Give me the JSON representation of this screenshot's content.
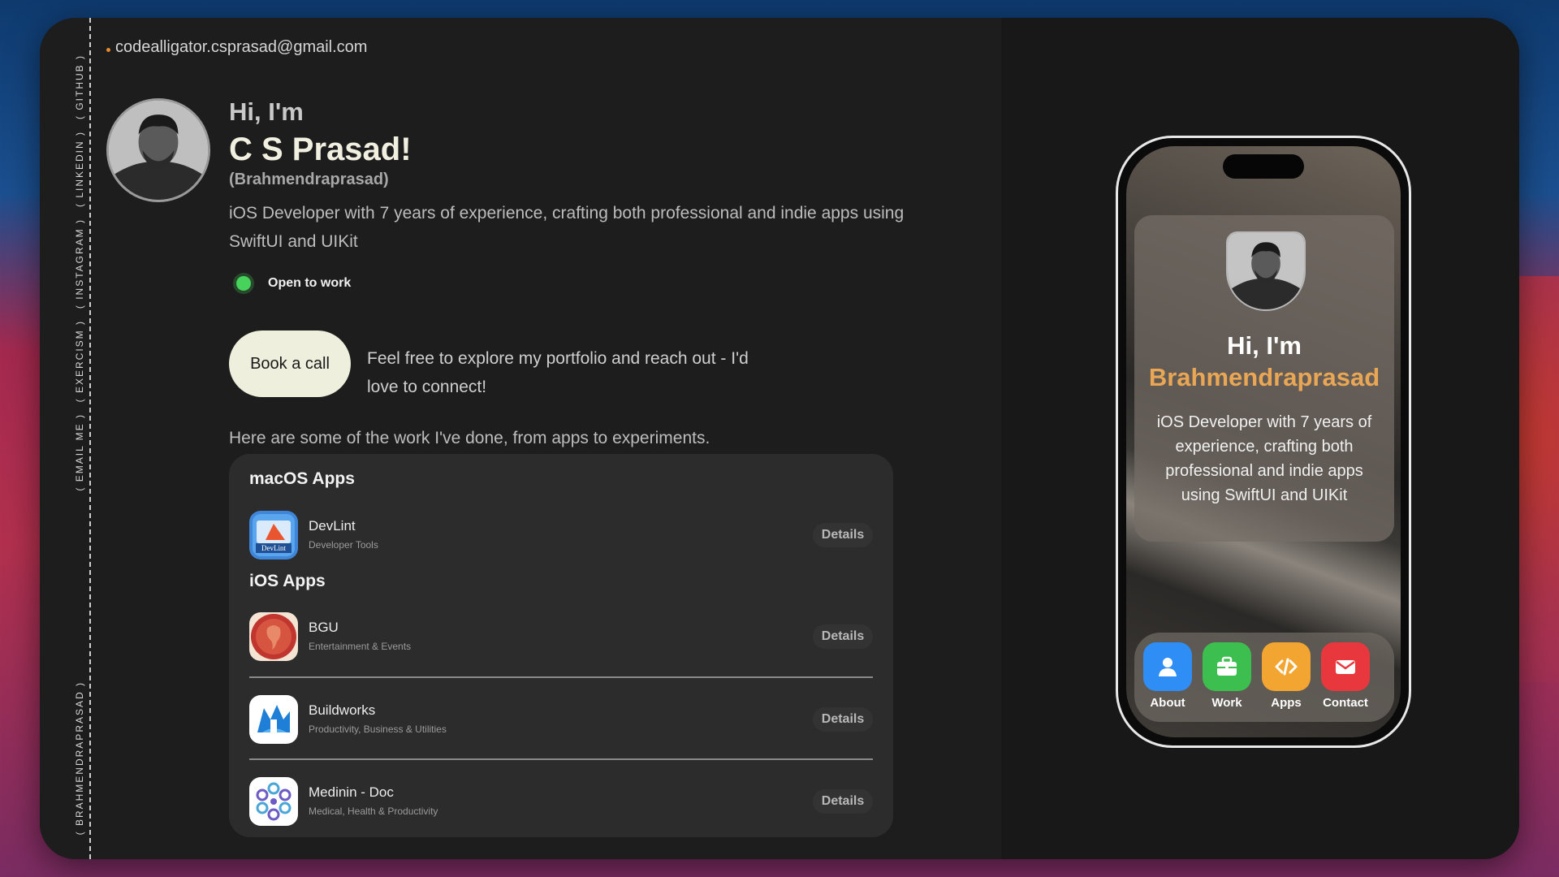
{
  "vertical_nav": {
    "items": [
      "( EMAIL ME )",
      "( EXERCISM )",
      "( INSTAGRAM )",
      "( LINKEDIN )",
      "( GITHUB )"
    ],
    "footer": "( BRAHMENDRAPRASAD )"
  },
  "header": {
    "email": "codealligator.csprasad@gmail.com"
  },
  "profile": {
    "greeting": "Hi, I'm",
    "name": "C S Prasad!",
    "alias": "(Brahmendraprasad)",
    "bio": "iOS Developer with 7 years of experience, crafting both professional and indie apps using SwiftUI and UIKit",
    "status": "Open to work",
    "status_color": "#47d25b"
  },
  "cta": {
    "button_label": "Book a call",
    "note": "Feel free to explore my portfolio and reach out - I'd love to connect!"
  },
  "work_intro": "Here are some of the work I've done, from apps to experiments.",
  "apps": {
    "sections": [
      {
        "title": "macOS Apps",
        "items": [
          {
            "name": "DevLint",
            "category": "Developer Tools",
            "icon": "devlint-icon",
            "button": "Details"
          }
        ]
      },
      {
        "title": "iOS Apps",
        "items": [
          {
            "name": "BGU",
            "category": "Entertainment & Events",
            "icon": "bgu-icon",
            "button": "Details"
          },
          {
            "name": "Buildworks",
            "category": "Productivity, Business & Utilities",
            "icon": "buildworks-icon",
            "button": "Details"
          },
          {
            "name": "Medinin - Doc",
            "category": "Medical, Health & Productivity",
            "icon": "medinin-icon",
            "button": "Details"
          }
        ]
      }
    ]
  },
  "phone": {
    "greeting": "Hi, I'm",
    "name": "Brahmendraprasad",
    "name_color": "#e9a755",
    "bio": "iOS Developer with 7 years of experience, crafting both professional and indie apps using SwiftUI and UIKit",
    "dock": [
      {
        "label": "About",
        "icon": "person-icon",
        "color": "#2f8ef5"
      },
      {
        "label": "Work",
        "icon": "briefcase-icon",
        "color": "#3dbf4f"
      },
      {
        "label": "Apps",
        "icon": "code-icon",
        "color": "#f3a531"
      },
      {
        "label": "Contact",
        "icon": "envelope-icon",
        "color": "#e8383d"
      }
    ]
  }
}
